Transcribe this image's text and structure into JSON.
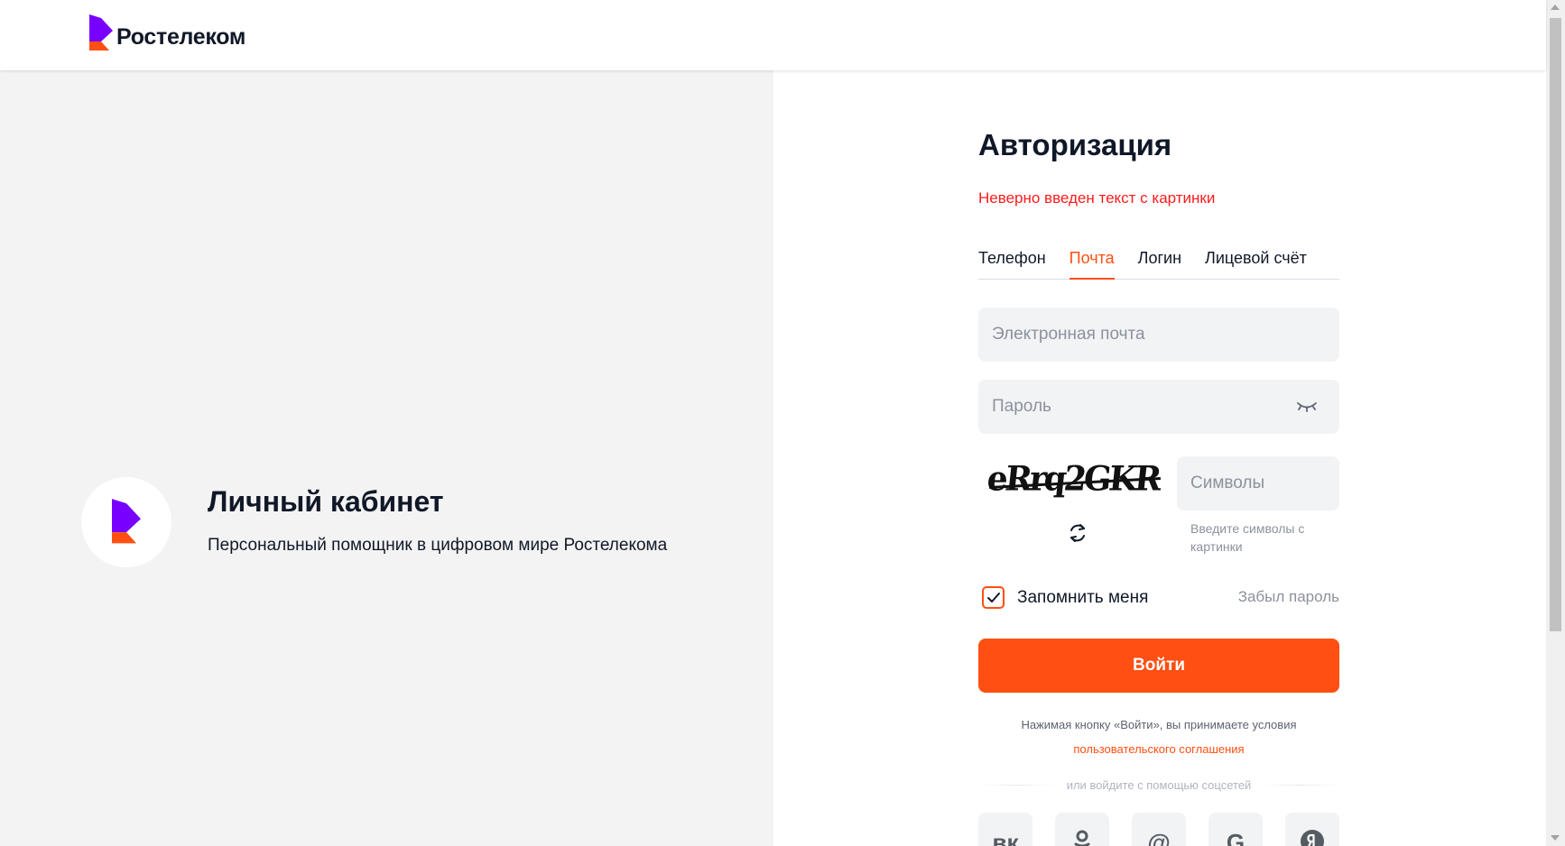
{
  "header": {
    "brand_name": "Ростелеком"
  },
  "promo": {
    "title": "Личный кабинет",
    "subtitle": "Персональный помощник в цифровом мире Ростелекома"
  },
  "auth": {
    "title": "Авторизация",
    "error": "Неверно введен текст с картинки",
    "tabs": [
      {
        "label": "Телефон",
        "active": false
      },
      {
        "label": "Почта",
        "active": true
      },
      {
        "label": "Логин",
        "active": false
      },
      {
        "label": "Лицевой счёт",
        "active": false
      }
    ],
    "email_placeholder": "Электронная почта",
    "password_placeholder": "Пароль",
    "captcha_text": "eRrq2GKR",
    "captcha_placeholder": "Символы",
    "captcha_hint": "Введите символы с картинки",
    "remember_label": "Запомнить меня",
    "remember_checked": true,
    "forgot_label": "Забыл пароль",
    "login_button": "Войти",
    "terms_text": "Нажимая кнопку «Войти», вы принимаете условия",
    "terms_link": "пользовательского соглашения",
    "social_divider": "или войдите с помощью соцсетей",
    "socials": [
      {
        "name": "vk-icon"
      },
      {
        "name": "odnoklassniki-icon"
      },
      {
        "name": "mail-ru-icon"
      },
      {
        "name": "google-icon"
      },
      {
        "name": "yandex-icon"
      }
    ]
  },
  "colors": {
    "accent": "#ff4f12",
    "brand_purple": "#7700ff",
    "error": "#ff1b1b",
    "left_bg": "#f3f3f3",
    "field_bg": "#f2f3f5"
  }
}
